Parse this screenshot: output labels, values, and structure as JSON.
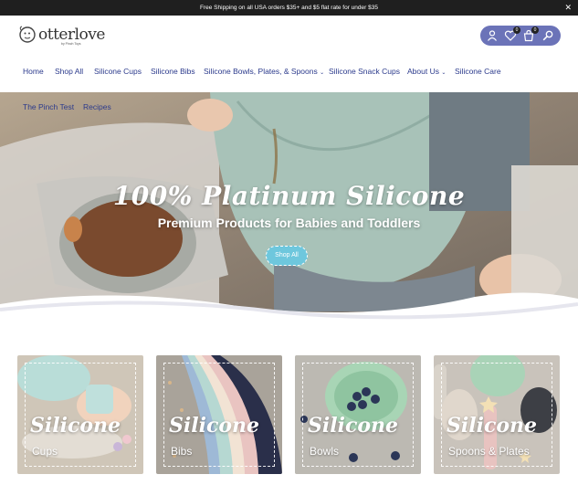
{
  "announcement": {
    "text": "Free Shipping on all USA orders $35+ and $5 flat rate for under $35",
    "close": "✕"
  },
  "brand": {
    "name": "otterlove",
    "tagline": "by Pinch Toys"
  },
  "header": {
    "wishlist_count": "0",
    "cart_count": "0"
  },
  "nav": {
    "items": [
      {
        "label": "Home"
      },
      {
        "label": "Shop All"
      },
      {
        "label": "Silicone Cups"
      },
      {
        "label": "Silicone Bibs"
      },
      {
        "label": "Silicone Bowls, Plates, & Spoons"
      },
      {
        "label": "Silicone Snack Cups"
      },
      {
        "label": "About Us"
      },
      {
        "label": "Silicone Care"
      },
      {
        "label": "The Pinch Test"
      },
      {
        "label": "Recipes"
      }
    ],
    "caret": "⌄"
  },
  "hero": {
    "title": "100% Platinum Silicone",
    "subtitle": "Premium Products for Babies and Toddlers",
    "button": "Shop All"
  },
  "categories": [
    {
      "title": "Silicone",
      "subtitle": "Cups"
    },
    {
      "title": "Silicone",
      "subtitle": "Bibs"
    },
    {
      "title": "Silicone",
      "subtitle": "Bowls"
    },
    {
      "title": "Silicone",
      "subtitle": "Spoons & Plates"
    }
  ],
  "colors": {
    "nav_text": "#2b3a8c",
    "header_pill": "#6b73b8",
    "hero_button": "#6ec7dd",
    "announcement_bg": "#1f1f1f"
  }
}
